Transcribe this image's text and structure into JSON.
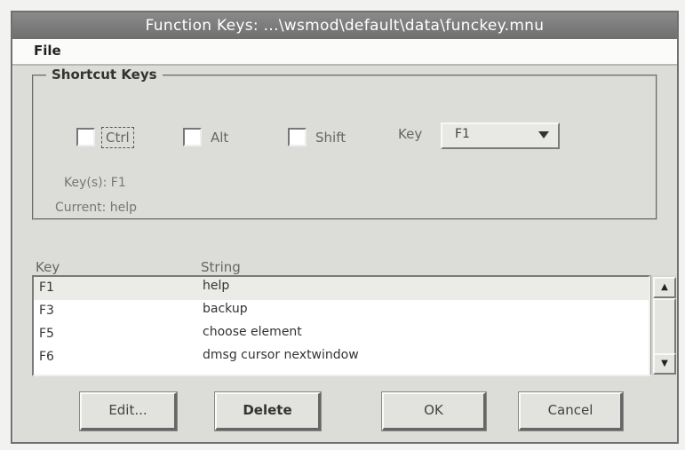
{
  "window": {
    "title": "Function Keys: ...\\wsmod\\default\\data\\funckey.mnu"
  },
  "menubar": {
    "file_label": "File"
  },
  "shortcut_keys": {
    "legend": "Shortcut Keys",
    "ctrl_label": "Ctrl",
    "alt_label": "Alt",
    "shift_label": "Shift",
    "key_label": "Key",
    "key_value": "F1",
    "keys_line": "Key(s): F1",
    "current_line": "Current: help"
  },
  "list": {
    "columns": [
      "Key",
      "String"
    ],
    "rows": [
      {
        "key": "F1",
        "string": "help"
      },
      {
        "key": "F3",
        "string": "backup"
      },
      {
        "key": "F5",
        "string": "choose element"
      },
      {
        "key": "F6",
        "string": "dmsg cursor nextwindow"
      }
    ]
  },
  "buttons": {
    "edit": "Edit...",
    "delete": "Delete",
    "ok": "OK",
    "cancel": "Cancel"
  },
  "colors": {
    "titlebar": "#777777",
    "dialog_bg": "#dcdcd8",
    "list_bg": "#ffffff"
  }
}
